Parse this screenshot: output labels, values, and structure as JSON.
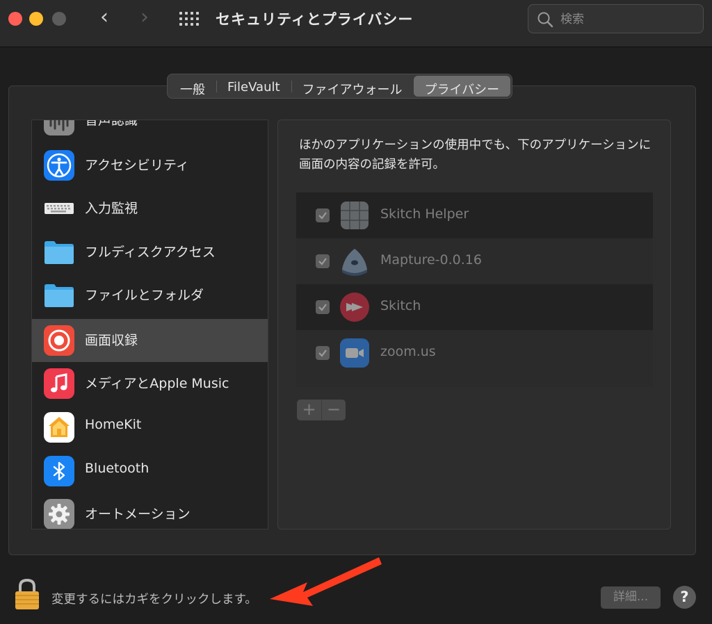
{
  "titlebar": {
    "title": "セキュリティとプライバシー",
    "back_glyph": "‹",
    "forward_glyph": "›",
    "search_placeholder": "検索"
  },
  "tabs": [
    {
      "label": "一般",
      "active": false
    },
    {
      "label": "FileVault",
      "active": false
    },
    {
      "label": "ファイアウォール",
      "active": false
    },
    {
      "label": "プライバシー",
      "active": true
    }
  ],
  "sidebar": {
    "items": [
      {
        "label": "音声認識",
        "icon": "waveform-icon"
      },
      {
        "label": "アクセシビリティ",
        "icon": "accessibility-icon"
      },
      {
        "label": "入力監視",
        "icon": "keyboard-icon"
      },
      {
        "label": "フルディスクアクセス",
        "icon": "folder-icon"
      },
      {
        "label": "ファイルとフォルダ",
        "icon": "folder-icon"
      },
      {
        "label": "画面収録",
        "icon": "screen-record-icon",
        "selected": true
      },
      {
        "label": "メディアとApple Music",
        "icon": "music-note-icon"
      },
      {
        "label": "HomeKit",
        "icon": "home-icon"
      },
      {
        "label": "Bluetooth",
        "icon": "bluetooth-icon"
      },
      {
        "label": "オートメーション",
        "icon": "gear-icon"
      }
    ]
  },
  "content": {
    "description": "ほかのアプリケーションの使用中でも、下のアプリケーションに画面の内容の記録を許可。",
    "apps": [
      {
        "name": "Skitch Helper",
        "checked": true,
        "icon": "skitch-helper-icon"
      },
      {
        "name": "Mapture-0.0.16",
        "checked": true,
        "icon": "mapture-icon"
      },
      {
        "name": "Skitch",
        "checked": true,
        "icon": "skitch-icon"
      },
      {
        "name": "zoom.us",
        "checked": true,
        "icon": "zoom-icon"
      }
    ],
    "add_label": "+",
    "remove_label": "−"
  },
  "footer": {
    "lock_text": "変更するにはカギをクリックします。",
    "details_label": "詳細...",
    "help_label": "?"
  },
  "colors": {
    "accent_arrow": "#ff3b1f",
    "close": "#ff5f57",
    "minimize": "#febc2e"
  }
}
